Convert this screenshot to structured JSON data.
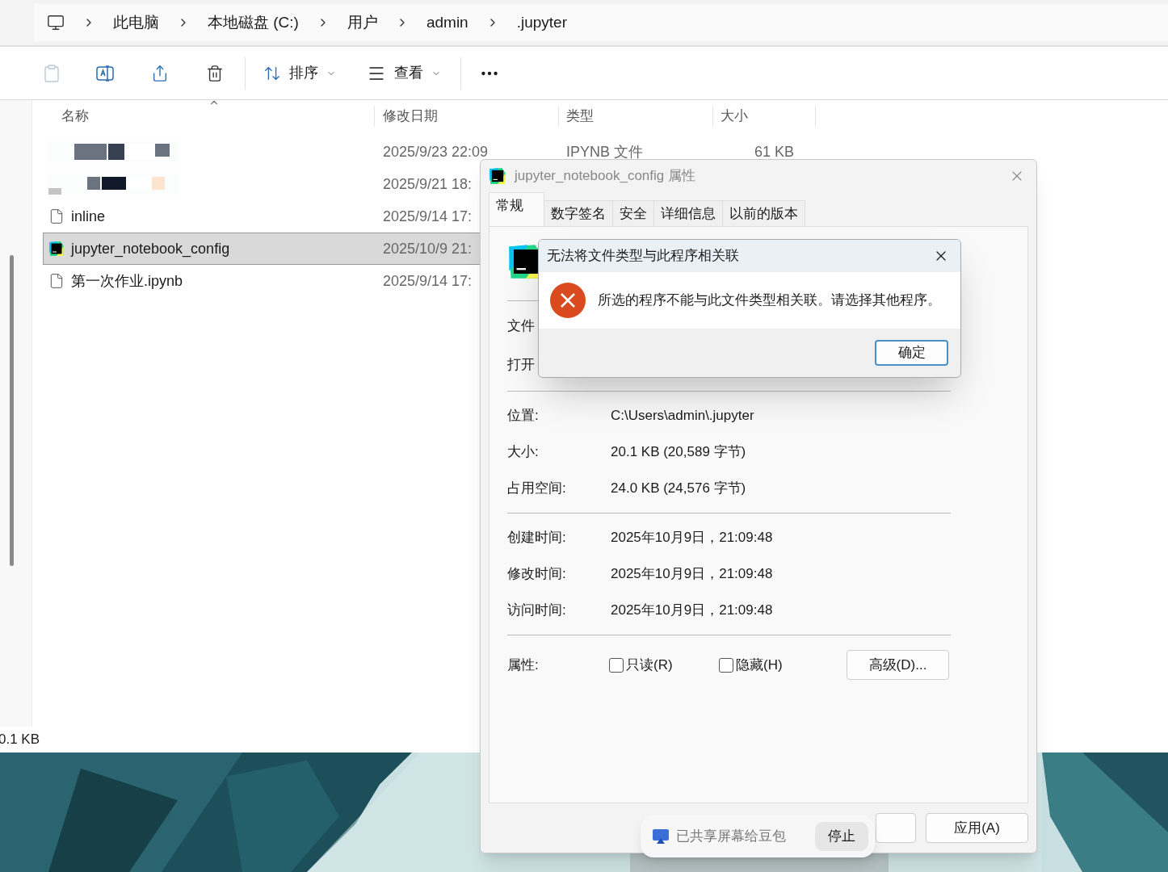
{
  "breadcrumb": [
    "此电脑",
    "本地磁盘 (C:)",
    "用户",
    "admin",
    ".jupyter"
  ],
  "toolbar": {
    "sort": "排序",
    "view": "查看"
  },
  "file_list": {
    "columns": [
      "名称",
      "修改日期",
      "类型",
      "大小"
    ],
    "rows": [
      {
        "kind": "redacted",
        "date": "2025/9/23 22:09",
        "type": "IPYNB 文件",
        "size": "61 KB",
        "selected": false
      },
      {
        "kind": "redacted",
        "date": "2025/9/21 18:",
        "selected": false
      },
      {
        "kind": "file",
        "name": "inline",
        "date": "2025/9/14 17:",
        "selected": false
      },
      {
        "kind": "pycharm",
        "name": "jupyter_notebook_config",
        "date": "2025/10/9 21:",
        "selected": true
      },
      {
        "kind": "file",
        "name": "第一次作业.ipynb",
        "date": "2025/9/14 17:",
        "selected": false
      }
    ]
  },
  "status_bar": {
    "text": "0.1 KB"
  },
  "properties_dialog": {
    "title": "jupyter_notebook_config 属性",
    "tabs": [
      {
        "label": "常规",
        "selected": true
      },
      {
        "label": "数字签名",
        "selected": false
      },
      {
        "label": "安全",
        "selected": false
      },
      {
        "label": "详细信息",
        "selected": false
      },
      {
        "label": "以前的版本",
        "selected": false
      }
    ],
    "covered_labels": [
      "文件",
      "打开"
    ],
    "info_groups": [
      [
        {
          "label": "位置:",
          "value": "C:\\Users\\admin\\.jupyter"
        },
        {
          "label": "大小:",
          "value": "20.1 KB (20,589 字节)"
        },
        {
          "label": "占用空间:",
          "value": "24.0 KB (24,576 字节)"
        }
      ],
      [
        {
          "label": "创建时间:",
          "value": "2025年10月9日，21:09:48"
        },
        {
          "label": "修改时间:",
          "value": "2025年10月9日，21:09:48"
        },
        {
          "label": "访问时间:",
          "value": "2025年10月9日，21:09:48"
        }
      ]
    ],
    "attributes": {
      "label": "属性:",
      "checkboxes": [
        {
          "label": "只读(R)",
          "checked": false
        },
        {
          "label": "隐藏(H)",
          "checked": false
        }
      ],
      "advanced_button": "高级(D)..."
    },
    "apply_button": "应用(A)"
  },
  "error_dialog": {
    "title": "无法将文件类型与此程序相关联",
    "message": "所选的程序不能与此文件类型相关联。请选择其他程序。",
    "ok_button": "确定"
  },
  "share_toast": {
    "text": "已共享屏幕给豆包",
    "stop_button": "停止"
  }
}
